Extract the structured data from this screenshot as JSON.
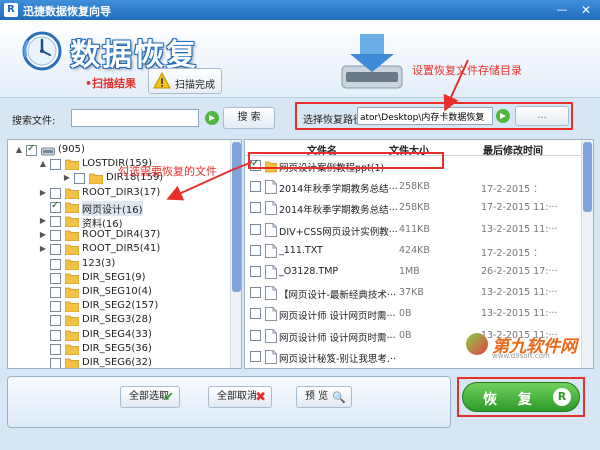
{
  "window": {
    "logo_letter": "R",
    "title": "迅捷数据恢复向导",
    "min_glyph": "—",
    "close_glyph": "✕"
  },
  "header": {
    "logo_text": "数据恢复",
    "step_scan": "•扫描结果",
    "step_done": "扫描完成",
    "annotation_path": "设置恢复文件存储目录"
  },
  "search": {
    "label": "搜索文件:",
    "value": "",
    "button": "搜 索"
  },
  "restore_path": {
    "label": "选择恢复路径",
    "value": "ator\\Desktop\\内存卡数据恢复",
    "browse": "..."
  },
  "tree": [
    {
      "label": "(905)",
      "level": 0,
      "toggle": "▲",
      "checked": true,
      "icon": "drive"
    },
    {
      "label": "LOSTDIR(159)",
      "level": 1,
      "toggle": "▲",
      "checked": false,
      "icon": "folder"
    },
    {
      "label": "DIR18(159)",
      "level": 2,
      "toggle": "▶",
      "checked": false,
      "icon": "folder"
    },
    {
      "label": "ROOT_DIR3(17)",
      "level": 1,
      "toggle": "▶",
      "checked": false,
      "icon": "folder"
    },
    {
      "label": "网页设计(16)",
      "level": 1,
      "toggle": "",
      "checked": true,
      "icon": "folder",
      "selected": true
    },
    {
      "label": "资料(16)",
      "level": 1,
      "toggle": "▶",
      "checked": false,
      "icon": "folder"
    },
    {
      "label": "ROOT_DIR4(37)",
      "level": 1,
      "toggle": "▶",
      "checked": false,
      "icon": "folder"
    },
    {
      "label": "ROOT_DIR5(41)",
      "level": 1,
      "toggle": "▶",
      "checked": false,
      "icon": "folder"
    },
    {
      "label": "123(3)",
      "level": 1,
      "toggle": "",
      "checked": false,
      "icon": "folder"
    },
    {
      "label": "DIR_SEG1(9)",
      "level": 1,
      "toggle": "",
      "checked": false,
      "icon": "folder"
    },
    {
      "label": "DIR_SEG10(4)",
      "level": 1,
      "toggle": "",
      "checked": false,
      "icon": "folder"
    },
    {
      "label": "DIR_SEG2(157)",
      "level": 1,
      "toggle": "",
      "checked": false,
      "icon": "folder"
    },
    {
      "label": "DIR_SEG3(28)",
      "level": 1,
      "toggle": "",
      "checked": false,
      "icon": "folder"
    },
    {
      "label": "DIR_SEG4(33)",
      "level": 1,
      "toggle": "",
      "checked": false,
      "icon": "folder"
    },
    {
      "label": "DIR_SEG5(36)",
      "level": 1,
      "toggle": "",
      "checked": false,
      "icon": "folder"
    },
    {
      "label": "DIR_SEG6(32)",
      "level": 1,
      "toggle": "",
      "checked": false,
      "icon": "folder"
    }
  ],
  "table": {
    "headers": {
      "name": "文件名",
      "size": "文件大小",
      "date": "最后修改时间"
    },
    "rows": [
      {
        "name": "网页设计案例教程ppt(1)",
        "size": "",
        "date": "",
        "checked": true,
        "icon": "folder"
      },
      {
        "name": "2014年秋季学期教务总结···",
        "size": "258KB",
        "date": "17-2-2015 ：",
        "checked": false,
        "icon": "doc"
      },
      {
        "name": "2014年秋季学期教务总结···",
        "size": "258KB",
        "date": "17-2-2015 11:···",
        "checked": false,
        "icon": "doc"
      },
      {
        "name": "DIV+CSS网页设计实例教···",
        "size": "411KB",
        "date": "13-2-2015 11:···",
        "checked": false,
        "icon": "doc"
      },
      {
        "name": "_111.TXT",
        "size": "424KB",
        "date": "17-2-2015 ：",
        "checked": false,
        "icon": "doc"
      },
      {
        "name": "_O3128.TMP",
        "size": "1MB",
        "date": "26-2-2015 17:···",
        "checked": false,
        "icon": "doc"
      },
      {
        "name": "【网页设计-最新经典技术···",
        "size": "37KB",
        "date": "13-2-2015 11:···",
        "checked": false,
        "icon": "doc"
      },
      {
        "name": "网页设计师 设计网页时需···",
        "size": "0B",
        "date": "13-2-2015 11:···",
        "checked": false,
        "icon": "doc"
      },
      {
        "name": "网页设计师 设计网页时需···",
        "size": "0B",
        "date": "13-2-2015 11:···",
        "checked": false,
        "icon": "doc"
      },
      {
        "name": "网页设计秘笈-别让我思考.···",
        "size": "",
        "date": "",
        "checked": false,
        "icon": "doc"
      }
    ]
  },
  "annotation_select": "勾选需要恢复的文件",
  "watermark": {
    "text": "第九软件网",
    "sub": "www.d9soft.com"
  },
  "buttons": {
    "select_all": "全部选取",
    "select_all_icon": "✔",
    "cancel_all": "全部取消",
    "cancel_all_icon": "✖",
    "preview": "预 览",
    "preview_icon": "🔍",
    "restore": "恢 复",
    "restore_icon": "R"
  },
  "colors": {
    "annotation_red": "#e8302a",
    "title_blue": "#1f6cbd",
    "restore_green": "#2d9a2a"
  }
}
